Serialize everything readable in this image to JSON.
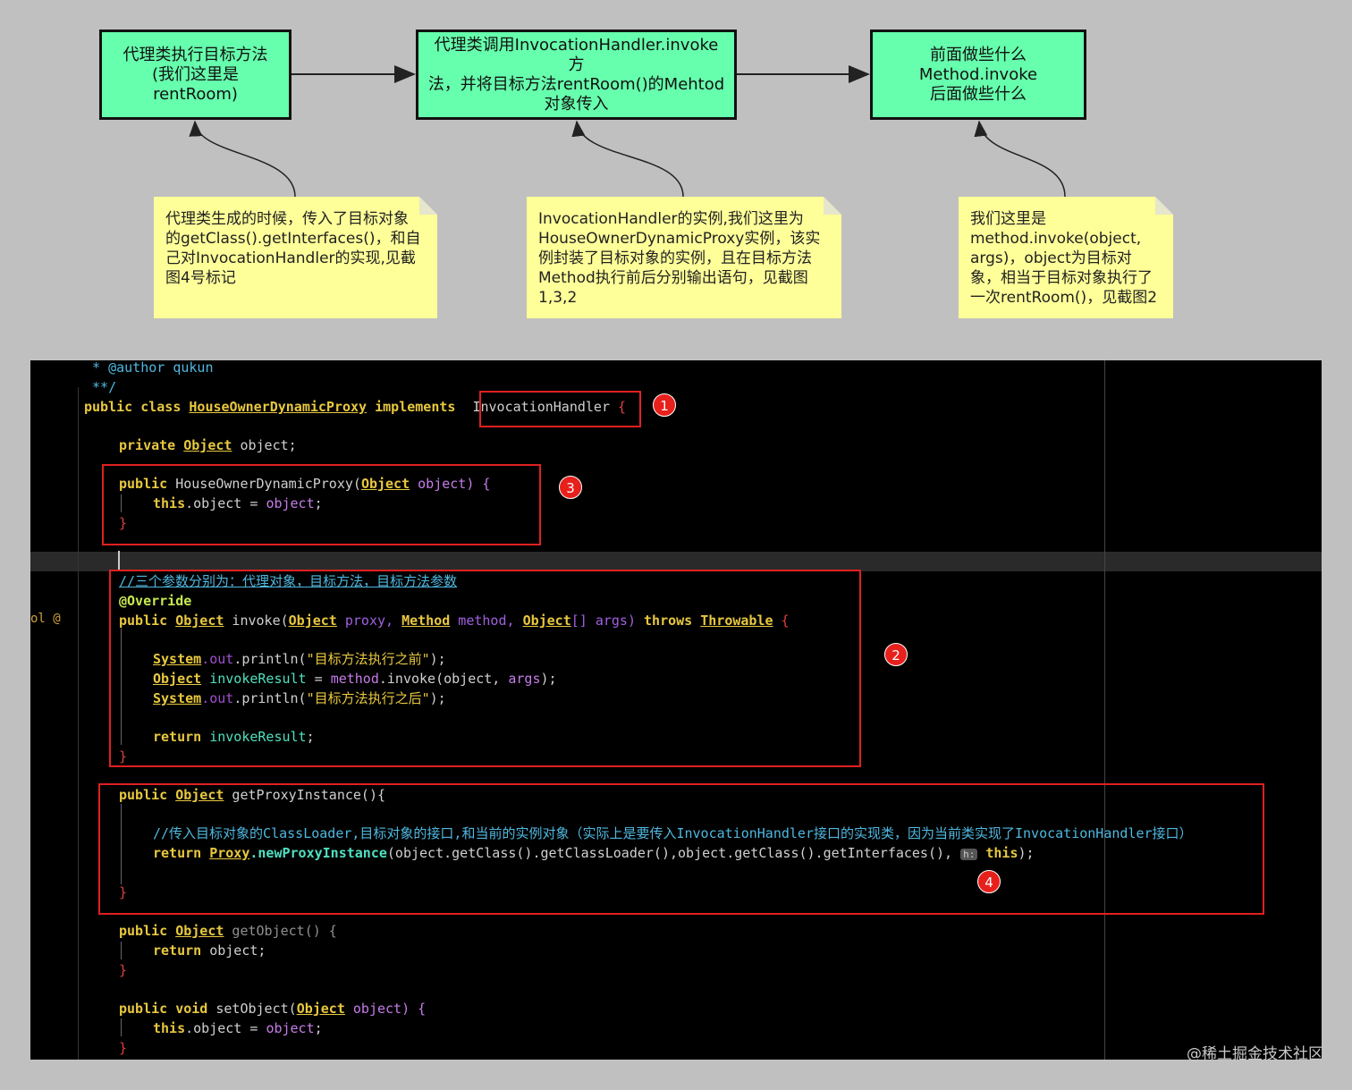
{
  "flow": {
    "box1": [
      "代理类执行目标方法",
      "(我们这里是",
      "rentRoom)"
    ],
    "box2": [
      "代理类调用InvocationHandler.invoke方",
      "法，并将目标方法rentRoom()的Mehtod",
      "对象传入"
    ],
    "box3": [
      "前面做些什么",
      "Method.invoke",
      "后面做些什么"
    ]
  },
  "notes": {
    "note1": [
      "代理类生成的时候，传入了目标对象",
      "的getClass().getInterfaces()，和自",
      "己对InvocationHandler的实现,见截",
      "图4号标记"
    ],
    "note2": [
      "InvocationHandler的实例,我们这里为",
      "HouseOwnerDynamicProxy实例，该实",
      "例封装了目标对象的实例，且在目标方法",
      "Method执行前后分别输出语句，见截图",
      "1,3,2"
    ],
    "note3": [
      "我们这里是",
      "method.invoke(object,",
      "args)，object为目标对",
      "象，相当于目标对象执行了",
      "一次rentRoom()，见截图2"
    ]
  },
  "code": {
    "l1_a": " * @author qukun",
    "l2_a": " **/",
    "l3_kw1": "public class ",
    "l3_cls": "HouseOwnerDynamicProxy",
    "l3_kw2": " implements ",
    "l3_iface": "InvocationHandler",
    "l3_brace": " {",
    "l4_kw": "private ",
    "l4_ty": "Object",
    "l4_id": " object;",
    "l5_kw": "public ",
    "l5_id": "HouseOwnerDynamicProxy(",
    "l5_ty": "Object",
    "l5_rest": " object) {",
    "l6_kw": "this",
    "l6_id": ".object = ",
    "l6_fld": "object",
    "l6_end": ";",
    "l7": "}",
    "l8_cm": "//三个参数分别为：代理对象，目标方法，目标方法参数",
    "l9_ann": "@Override",
    "l10_kw": "public ",
    "l10_ty1": "Object",
    "l10_id": " invoke(",
    "l10_ty2": "Object",
    "l10_p1": " proxy, ",
    "l10_ty3": "Method",
    "l10_p2": " method, ",
    "l10_ty4": "Object",
    "l10_p3": "[] args) ",
    "l10_kw2": "throws ",
    "l10_ty5": "Throwable",
    "l10_end": " {",
    "l11_ty": "System",
    "l11_fld": ".out",
    "l11_id": ".println(",
    "l11_str": "\"目标方法执行之前\"",
    "l11_end": ");",
    "l12_ty": "Object",
    "l12_var": " invokeResult",
    "l12_id": " = ",
    "l12_fld": "method",
    "l12_rest": ".invoke(object, ",
    "l12_fld2": "args",
    "l12_end": ");",
    "l13_ty": "System",
    "l13_fld": ".out",
    "l13_id": ".println(",
    "l13_str": "\"目标方法执行之后\"",
    "l13_end": ");",
    "l14_kw": "return ",
    "l14_var": "invokeResult",
    "l14_end": ";",
    "l15": "}",
    "l16_kw": "public ",
    "l16_ty": "Object",
    "l16_id": " getProxyInstance(){",
    "l17_cm": "//传入目标对象的ClassLoader,目标对象的接口,和当前的实例对象（实际上是要传入InvocationHandler接口的实现类，因为当前类实现了InvocationHandler接口）",
    "l18_kw": "return ",
    "l18_ty": "Proxy",
    "l18_m": ".newProxyInstance",
    "l18_rest": "(object.getClass().getClassLoader(),object.getClass().getInterfaces(), ",
    "l18_hint": "h:",
    "l18_kw2": " this",
    "l18_end": ");",
    "l19": "}",
    "l20_kw": "public ",
    "l20_ty": "Object",
    "l20_id": " getObject() {",
    "l21_kw": "return ",
    "l21_id": "object;",
    "l22": "}",
    "l23_kw": "public void ",
    "l23_id": "setObject(",
    "l23_ty": "Object",
    "l23_rest": " object) {",
    "l24_kw": "this",
    "l24_id": ".object = ",
    "l24_fld": "object",
    "l24_end": ";",
    "l25": "}",
    "gutter_mark": "ol @"
  },
  "badges": [
    "1",
    "3",
    "2",
    "4"
  ],
  "watermark": "@稀土掘金技术社区"
}
